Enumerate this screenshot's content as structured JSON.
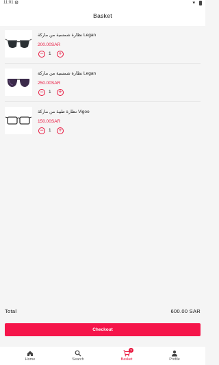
{
  "status_bar": {
    "time": "11:01"
  },
  "header": {
    "title": "Basket"
  },
  "cart": {
    "items": [
      {
        "name": "نظارة شمسية من ماركة Legan",
        "price": "200.00SAR",
        "quantity": "1",
        "thumb_icon": "dark-sunglasses-icon"
      },
      {
        "name": "نظارة شمسية من ماركة Legan",
        "price": "250.00SAR",
        "quantity": "1",
        "thumb_icon": "purple-sunglasses-icon"
      },
      {
        "name": "نظارة طبية من ماركة Vigoo",
        "price": "150.00SAR",
        "quantity": "1",
        "thumb_icon": "eyeglasses-icon"
      }
    ]
  },
  "summary": {
    "total_label": "Total",
    "total_value": "600.00 SAR"
  },
  "checkout": {
    "label": "Checkout"
  },
  "bottom_nav": {
    "items": [
      {
        "label": "Home",
        "icon": "home-icon"
      },
      {
        "label": "Search",
        "icon": "search-icon"
      },
      {
        "label": "Basket",
        "icon": "cart-icon",
        "badge": "3",
        "active": true
      },
      {
        "label": "Profile",
        "icon": "person-icon"
      }
    ]
  },
  "colors": {
    "accent": "#e8153d",
    "button": "#f5154a",
    "background": "#f5f5f5"
  }
}
